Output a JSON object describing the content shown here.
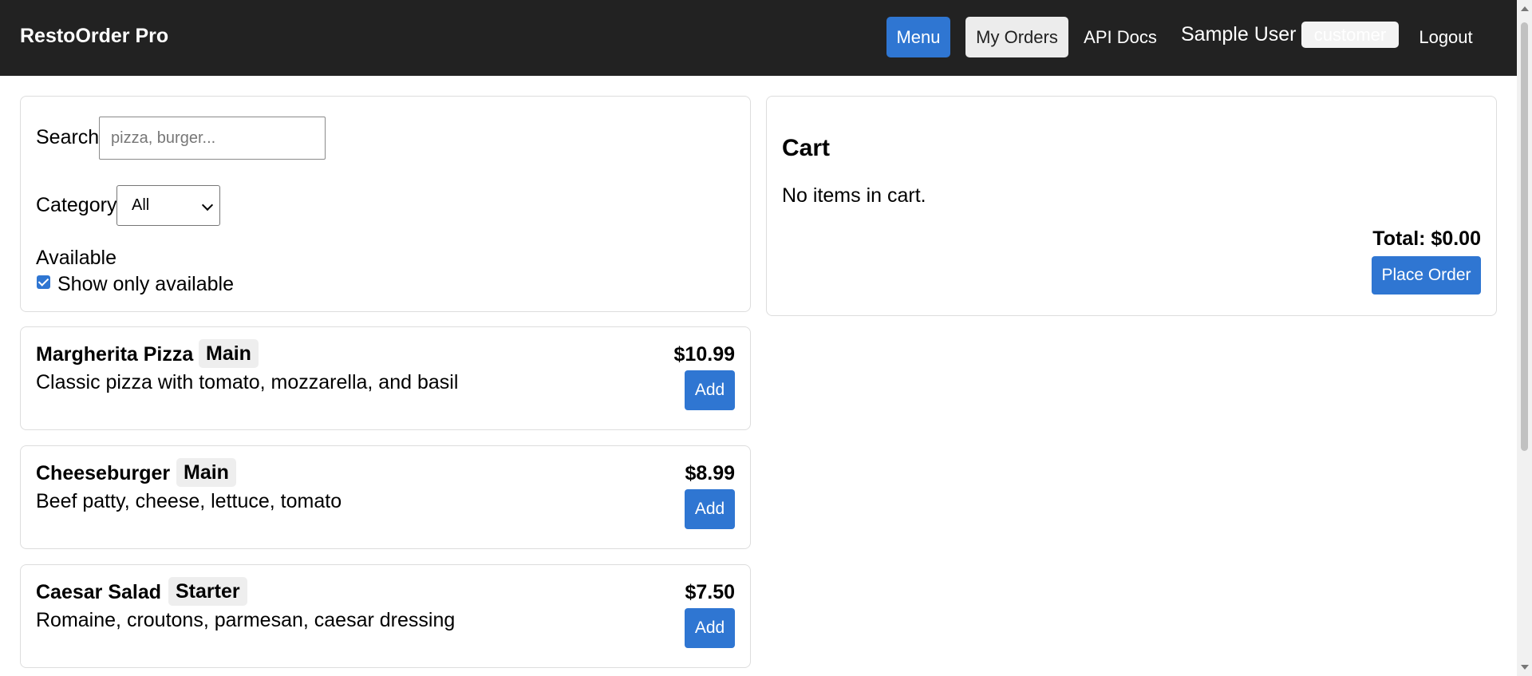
{
  "header": {
    "brand": "RestoOrder Pro",
    "nav": {
      "menu": "Menu",
      "my_orders": "My Orders",
      "api_docs": "API Docs",
      "logout": "Logout"
    },
    "user_name": "Sample User",
    "user_role": "customer"
  },
  "filters": {
    "search_label": "Search",
    "search_placeholder": "pizza, burger...",
    "search_value": "",
    "category_label": "Category",
    "category_selected": "All",
    "available_label": "Available",
    "available_checkbox_label": "Show only available",
    "available_checked": true
  },
  "menu_items": [
    {
      "name": "Margherita Pizza",
      "category": "Main",
      "description": "Classic pizza with tomato, mozzarella, and basil",
      "price": "$10.99",
      "add_label": "Add"
    },
    {
      "name": "Cheeseburger",
      "category": "Main",
      "description": "Beef patty, cheese, lettuce, tomato",
      "price": "$8.99",
      "add_label": "Add"
    },
    {
      "name": "Caesar Salad",
      "category": "Starter",
      "description": "Romaine, croutons, parmesan, caesar dressing",
      "price": "$7.50",
      "add_label": "Add"
    }
  ],
  "cart": {
    "title": "Cart",
    "empty_message": "No items in cart.",
    "total": "Total: $0.00",
    "place_order_label": "Place Order"
  },
  "colors": {
    "accent": "#2f76d2",
    "topbar": "#222222"
  }
}
